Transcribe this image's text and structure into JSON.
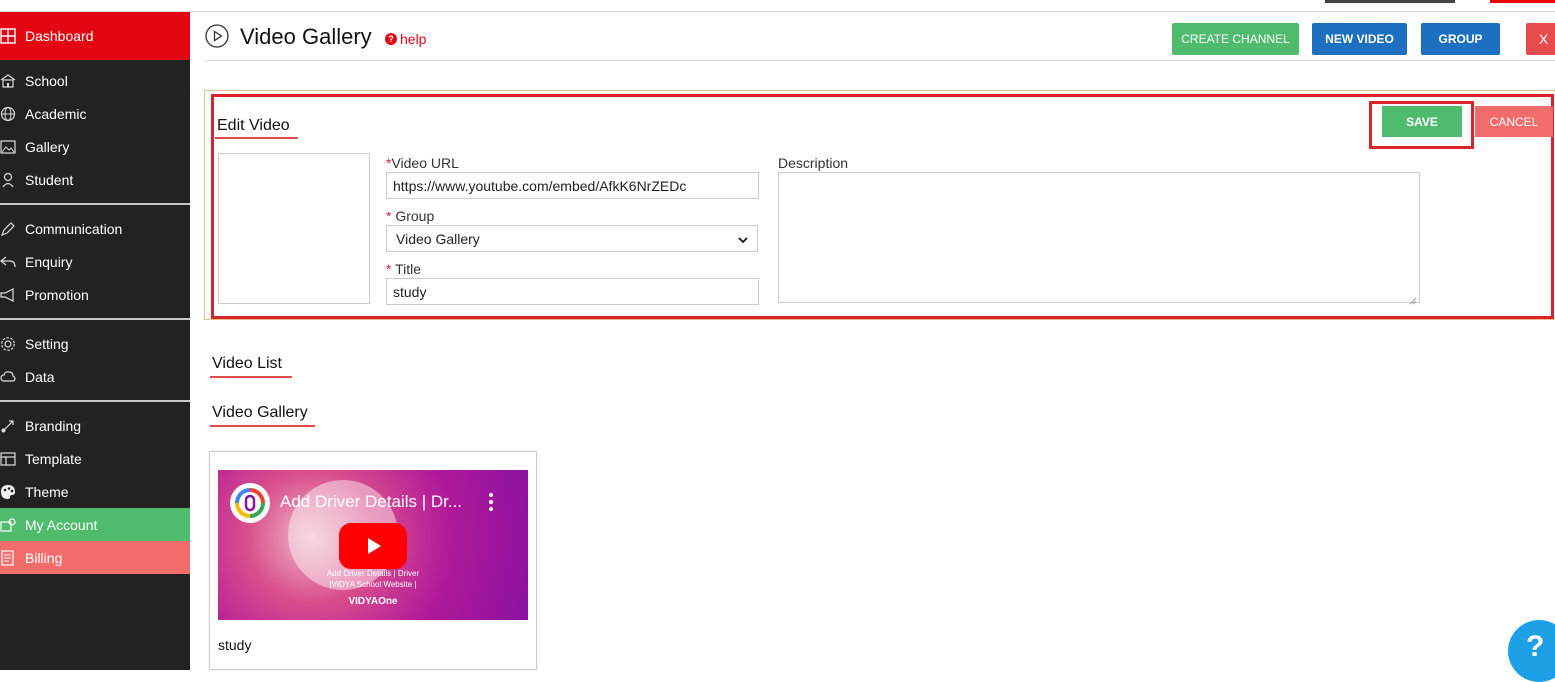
{
  "sidebar": {
    "items": [
      {
        "label": "Dashboard",
        "icon": "grid-icon"
      },
      {
        "label": "School",
        "icon": "school-icon"
      },
      {
        "label": "Academic",
        "icon": "globe-icon"
      },
      {
        "label": "Gallery",
        "icon": "image-icon"
      },
      {
        "label": "Student",
        "icon": "student-icon"
      },
      {
        "label": "Communication",
        "icon": "pen-icon"
      },
      {
        "label": "Enquiry",
        "icon": "reply-icon"
      },
      {
        "label": "Promotion",
        "icon": "megaphone-icon"
      },
      {
        "label": "Setting",
        "icon": "gear-icon"
      },
      {
        "label": "Data",
        "icon": "cloud-icon"
      },
      {
        "label": "Branding",
        "icon": "brush-icon"
      },
      {
        "label": "Template",
        "icon": "layout-icon"
      },
      {
        "label": "Theme",
        "icon": "palette-icon"
      },
      {
        "label": "My Account",
        "icon": "account-icon"
      },
      {
        "label": "Billing",
        "icon": "billing-icon"
      }
    ],
    "colors": {
      "dashboard": "#e30613",
      "my_account": "#4fbb6c",
      "billing": "#f26c6c",
      "bg": "#222222"
    }
  },
  "header": {
    "title": "Video Gallery",
    "help": "help",
    "buttons": {
      "create_channel": "CREATE CHANNEL",
      "new_video": "NEW VIDEO",
      "group": "GROUP",
      "close": "X"
    }
  },
  "edit_video": {
    "title": "Edit Video",
    "save": "SAVE",
    "cancel": "CANCEL",
    "required_mark": "*",
    "video_url_label": "Video URL",
    "video_url_value": "https://www.youtube.com/embed/AfkK6NrZEDc",
    "group_label": "Group",
    "group_value": "Video Gallery",
    "title_label": "Title",
    "title_value": "study",
    "description_label": "Description",
    "description_value": ""
  },
  "video_list": {
    "title": "Video List",
    "gallery_title": "Video Gallery",
    "cards": [
      {
        "title": "study",
        "embed_title": "Add Driver Details | Dr...",
        "embed_caption_1": "Add Driver Details | Driver",
        "embed_caption_2": "|VIDYA School Website |",
        "embed_brand": "VIDYAOne"
      }
    ]
  },
  "help_fab": "?"
}
